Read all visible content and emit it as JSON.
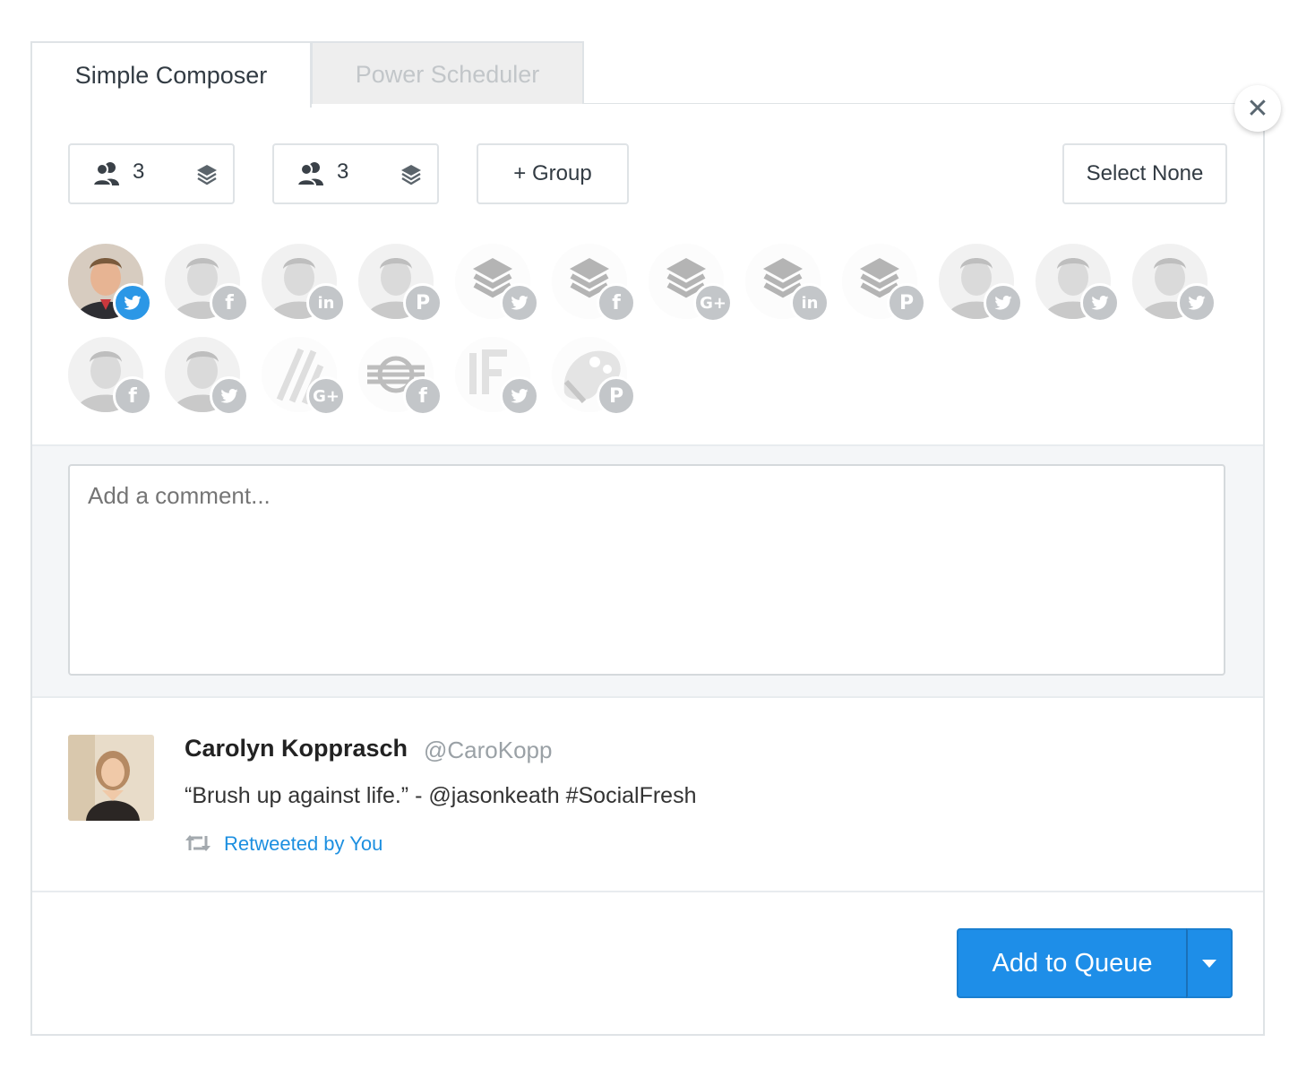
{
  "tabs": [
    {
      "label": "Simple Composer",
      "active": true
    },
    {
      "label": "Power Scheduler",
      "active": false
    }
  ],
  "close_icon": "close-icon",
  "toolbar": {
    "group1_count": "3",
    "group2_count": "3",
    "add_group_label": "+ Group",
    "select_none_label": "Select None"
  },
  "profiles": [
    {
      "type": "person",
      "network": "twitter",
      "selected": true
    },
    {
      "type": "person",
      "network": "facebook",
      "selected": false
    },
    {
      "type": "person",
      "network": "linkedin",
      "selected": false
    },
    {
      "type": "person",
      "network": "pinterest",
      "selected": false
    },
    {
      "type": "buffer-logo",
      "network": "twitter",
      "selected": false
    },
    {
      "type": "buffer-logo",
      "network": "facebook",
      "selected": false
    },
    {
      "type": "buffer-logo",
      "network": "google-plus",
      "selected": false
    },
    {
      "type": "buffer-logo",
      "network": "linkedin",
      "selected": false
    },
    {
      "type": "buffer-logo",
      "network": "pinterest",
      "selected": false
    },
    {
      "type": "person",
      "network": "twitter",
      "selected": false
    },
    {
      "type": "person",
      "network": "twitter",
      "selected": false
    },
    {
      "type": "person",
      "network": "twitter",
      "selected": false
    },
    {
      "type": "person",
      "network": "facebook",
      "selected": false
    },
    {
      "type": "person",
      "network": "twitter",
      "selected": false
    },
    {
      "type": "slash-logo",
      "network": "google-plus",
      "selected": false
    },
    {
      "type": "lines-logo",
      "network": "facebook",
      "selected": false
    },
    {
      "type": "if-logo",
      "network": "twitter",
      "selected": false
    },
    {
      "type": "palette-logo",
      "network": "pinterest",
      "selected": false
    }
  ],
  "comment": {
    "placeholder": "Add a comment..."
  },
  "tweet": {
    "name": "Carolyn Kopprasch",
    "handle": "@CaroKopp",
    "text": "“Brush up against life.” - @jasonkeath #SocialFresh",
    "retweet_label": "Retweeted by You"
  },
  "actions": {
    "queue_label": "Add to Queue"
  },
  "colors": {
    "accent": "#1e8ee8",
    "twitter": "#2b97e6",
    "badge_grey": "#c3c6c9"
  }
}
